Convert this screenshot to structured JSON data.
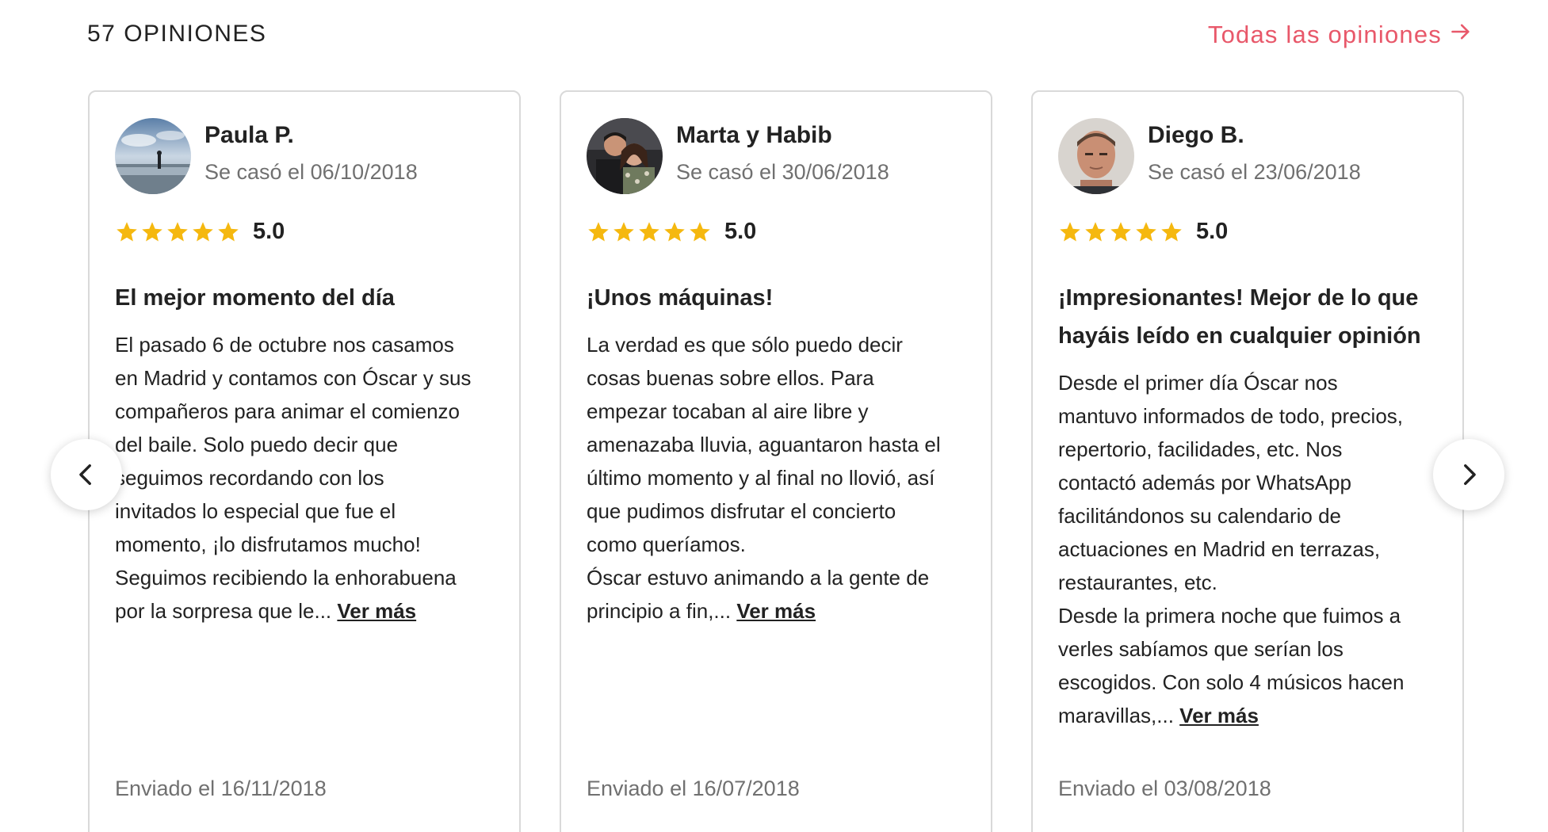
{
  "header": {
    "count_label": "57 OPINIONES",
    "all_reviews_link": "Todas las opiniones",
    "arrow_icon": "arrow-right-icon"
  },
  "colors": {
    "accent": "#e8586a",
    "star": "#f5b80f",
    "muted_text": "#707070",
    "card_border": "#d9d9d9"
  },
  "reviews": [
    {
      "name": "Paula P.",
      "wedding_date": "Se casó el 06/10/2018",
      "rating": 5,
      "rating_label": "5.0",
      "title": "El mejor momento del día",
      "body": "El pasado 6 de octubre nos casamos\nen Madrid y contamos con Óscar y sus\ncompañeros para animar el comienzo\ndel baile. Solo puedo decir que\nseguimos recordando con los\ninvitados lo especial que fue el\nmomento, ¡lo disfrutamos mucho!\nSeguimos recibiendo la enhorabuena\npor la sorpresa que le... ",
      "more": "Ver más",
      "sent": "Enviado el 16/11/2018"
    },
    {
      "name": "Marta y Habib",
      "wedding_date": "Se casó el 30/06/2018",
      "rating": 5,
      "rating_label": "5.0",
      "title": "¡Unos máquinas!",
      "body": "La verdad es que sólo puedo decir\ncosas buenas sobre ellos. Para\nempezar tocaban al aire libre y\namenazaba lluvia, aguantaron hasta el\núltimo momento y al final no llovió, así\nque pudimos disfrutar el concierto\ncomo queríamos.\nÓscar estuvo animando a la gente de\nprincipio a fin,... ",
      "more": "Ver más",
      "sent": "Enviado el 16/07/2018"
    },
    {
      "name": "Diego B.",
      "wedding_date": "Se casó el 23/06/2018",
      "rating": 5,
      "rating_label": "5.0",
      "title": "¡Impresionantes! Mejor de lo que hayáis leído en cualquier opinión",
      "body": "Desde el primer día Óscar nos\nmantuvo informados de todo, precios,\nrepertorio, facilidades, etc. Nos\ncontactó además por WhatsApp\nfacilitándonos su calendario de\nactuaciones en Madrid en terrazas,\nrestaurantes, etc.\nDesde la primera noche que fuimos a\nverles sabíamos que serían los\nescogidos. Con solo 4 músicos hacen\nmaravillas,... ",
      "more": "Ver más",
      "sent": "Enviado el 03/08/2018"
    }
  ],
  "nav": {
    "prev_icon": "chevron-left-icon",
    "next_icon": "chevron-right-icon"
  }
}
